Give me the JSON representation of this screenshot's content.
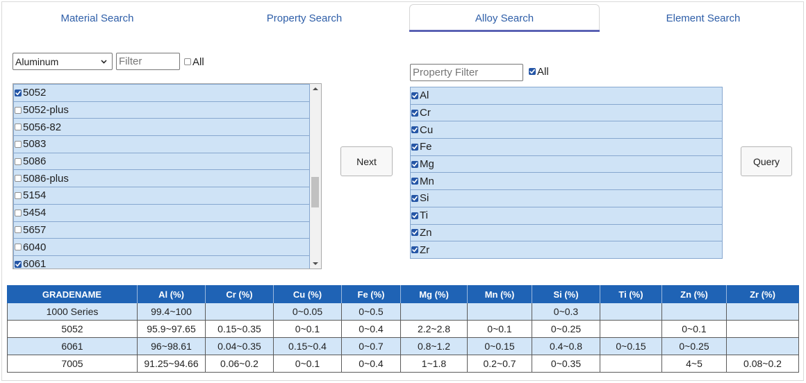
{
  "colors": {
    "tab_text": "#2e5ea8",
    "tab_underline": "#5b62b4",
    "list_row_bg": "#cfe3f6",
    "list_border": "#86a7cf",
    "checkbox_checked": "#2556a6",
    "table_header_bg": "#1f63b5",
    "table_stripe_bg": "#d3e6f8"
  },
  "icons": {
    "select_dropdown": "chevron-down-icon",
    "checkbox_mark": "check-icon",
    "scroll_up": "scroll-up-arrow-icon",
    "scroll_down": "scroll-down-arrow-icon"
  },
  "tabs": [
    {
      "label": "Material Search",
      "active": false
    },
    {
      "label": "Property Search",
      "active": false
    },
    {
      "label": "Alloy Search",
      "active": true
    },
    {
      "label": "Element Search",
      "active": false
    }
  ],
  "grade_panel": {
    "material_select": {
      "value": "Aluminum"
    },
    "filter_input": {
      "placeholder": "Filter",
      "value": ""
    },
    "select_all": {
      "label": "All",
      "checked": false
    },
    "grades": [
      {
        "label": "5052",
        "checked": true
      },
      {
        "label": "5052-plus",
        "checked": false
      },
      {
        "label": "5056-82",
        "checked": false
      },
      {
        "label": "5083",
        "checked": false
      },
      {
        "label": "5086",
        "checked": false
      },
      {
        "label": "5086-plus",
        "checked": false
      },
      {
        "label": "5154",
        "checked": false
      },
      {
        "label": "5454",
        "checked": false
      },
      {
        "label": "5657",
        "checked": false
      },
      {
        "label": "6040",
        "checked": false
      },
      {
        "label": "6061",
        "checked": true
      }
    ]
  },
  "next_button": {
    "label": "Next"
  },
  "property_panel": {
    "filter_input": {
      "placeholder": "Property Filter",
      "value": ""
    },
    "select_all": {
      "label": "All",
      "checked": true
    },
    "properties": [
      {
        "label": "Al",
        "checked": true
      },
      {
        "label": "Cr",
        "checked": true
      },
      {
        "label": "Cu",
        "checked": true
      },
      {
        "label": "Fe",
        "checked": true
      },
      {
        "label": "Mg",
        "checked": true
      },
      {
        "label": "Mn",
        "checked": true
      },
      {
        "label": "Si",
        "checked": true
      },
      {
        "label": "Ti",
        "checked": true
      },
      {
        "label": "Zn",
        "checked": true
      },
      {
        "label": "Zr",
        "checked": true
      }
    ]
  },
  "query_button": {
    "label": "Query"
  },
  "results_table": {
    "columns": [
      "GRADENAME",
      "Al (%)",
      "Cr (%)",
      "Cu (%)",
      "Fe (%)",
      "Mg (%)",
      "Mn (%)",
      "Si (%)",
      "Ti (%)",
      "Zn (%)",
      "Zr (%)"
    ],
    "rows": [
      [
        "1000 Series",
        "99.4~100",
        "",
        "0~0.05",
        "0~0.5",
        "",
        "",
        "0~0.3",
        "",
        "",
        ""
      ],
      [
        "5052",
        "95.9~97.65",
        "0.15~0.35",
        "0~0.1",
        "0~0.4",
        "2.2~2.8",
        "0~0.1",
        "0~0.25",
        "",
        "0~0.1",
        ""
      ],
      [
        "6061",
        "96~98.61",
        "0.04~0.35",
        "0.15~0.4",
        "0~0.7",
        "0.8~1.2",
        "0~0.15",
        "0.4~0.8",
        "0~0.15",
        "0~0.25",
        ""
      ],
      [
        "7005",
        "91.25~94.66",
        "0.06~0.2",
        "0~0.1",
        "0~0.4",
        "1~1.8",
        "0.2~0.7",
        "0~0.35",
        "",
        "4~5",
        "0.08~0.2"
      ]
    ]
  }
}
